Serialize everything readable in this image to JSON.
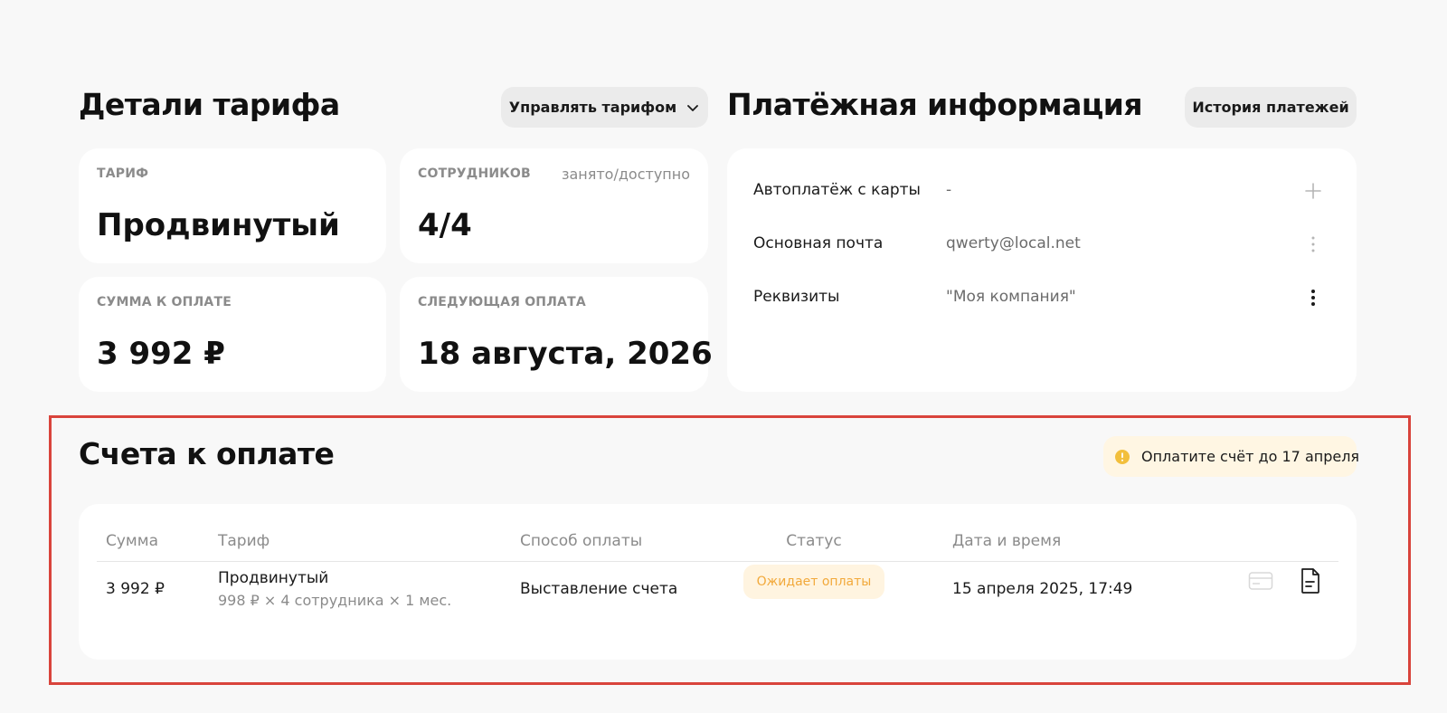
{
  "tariff_section": {
    "title": "Детали тарифа",
    "manage_button": "Управлять тарифом",
    "cards": {
      "tariff": {
        "label": "ТАРИФ",
        "value": "Продвинутый"
      },
      "employees": {
        "label": "СОТРУДНИКОВ",
        "hint": "занято/доступно",
        "value": "4/4"
      },
      "amount": {
        "label": "СУММА К ОПЛАТЕ",
        "value": "3 992 ₽"
      },
      "next_payment": {
        "label": "СЛЕДУЮЩАЯ ОПЛАТА",
        "value": "18 августа, 2026"
      }
    }
  },
  "payment_section": {
    "title": "Платёжная информация",
    "history_button": "История платежей",
    "rows": [
      {
        "label": "Автоплатёж с карты",
        "value": "-",
        "action_icon": "plus-icon"
      },
      {
        "label": "Основная почта",
        "value": "qwerty@local.net",
        "action_icon": "more-vertical-icon"
      },
      {
        "label": "Реквизиты",
        "value": "\"Моя компания\"",
        "action_icon": "more-vertical-icon"
      }
    ]
  },
  "invoices_section": {
    "title": "Счета к оплате",
    "notice": "Оплатите счёт до 17 апреля",
    "table": {
      "headers": {
        "sum": "Сумма",
        "tariff": "Тариф",
        "method": "Способ оплаты",
        "status": "Статус",
        "datetime": "Дата и время"
      },
      "rows": [
        {
          "sum": "3 992 ₽",
          "tariff": "Продвинутый",
          "tariff_detail": "998 ₽ × 4 сотрудника × 1 мес.",
          "method": "Выставление счета",
          "status": "Ожидает оплаты",
          "datetime": "15 апреля 2025, 17:49"
        }
      ]
    }
  },
  "colors": {
    "background": "#f8f8f8",
    "card": "#ffffff",
    "highlight_frame": "#d9443c",
    "warning_bg": "#fff6e3",
    "warning_icon": "#f2bf3c",
    "status_bg": "#fff4e0",
    "status_text": "#f2a93b"
  }
}
